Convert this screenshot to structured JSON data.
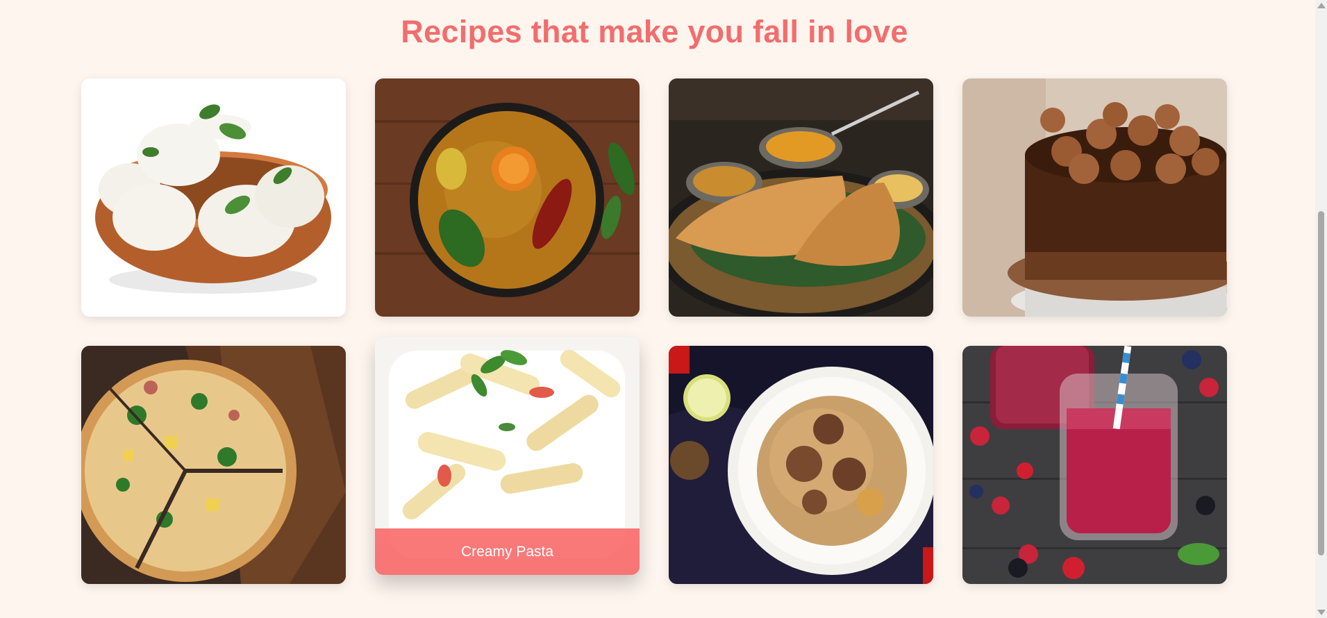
{
  "section": {
    "title": "Recipes that make you fall in love"
  },
  "cards": [
    {
      "image": "idli-photo"
    },
    {
      "image": "sambar-photo"
    },
    {
      "image": "dosa-photo"
    },
    {
      "image": "chocolate-cake-photo"
    },
    {
      "image": "pizza-photo"
    },
    {
      "image": "creamy-pasta-photo",
      "caption": "Creamy Pasta",
      "hovered": true
    },
    {
      "image": "biryani-photo"
    },
    {
      "image": "berry-smoothie-photo"
    }
  ],
  "colors": {
    "title": "#f26d6d",
    "caption_bg": "#f96c6c",
    "page_bg": "#fdf5ee"
  },
  "icons": {
    "scroll_up": "scroll-up-arrow-icon",
    "scroll_down": "scroll-down-arrow-icon"
  }
}
